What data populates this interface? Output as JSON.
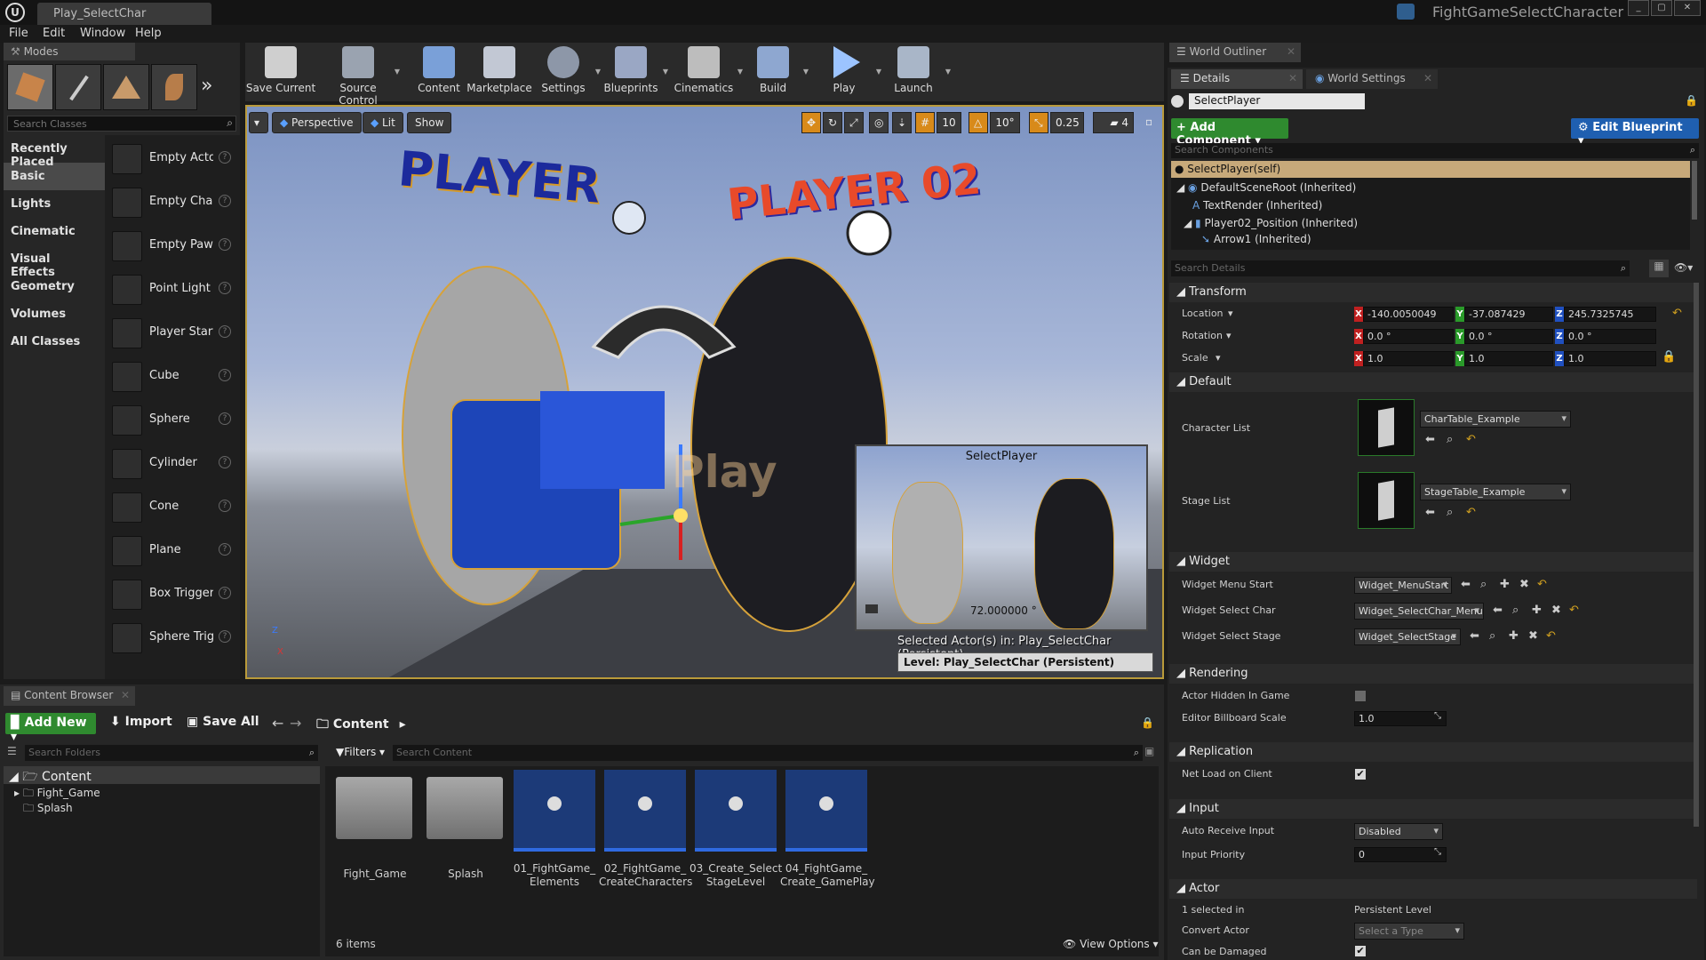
{
  "window": {
    "tab_title": "Play_SelectChar",
    "project_name": "FightGameSelectCharacter"
  },
  "menu": [
    "File",
    "Edit",
    "Window",
    "Help"
  ],
  "modes": {
    "panel_title": "Modes",
    "search_placeholder": "Search Classes",
    "categories": [
      "Recently Placed",
      "Basic",
      "Lights",
      "Cinematic",
      "Visual Effects",
      "Geometry",
      "Volumes",
      "All Classes"
    ],
    "selected_category": "Basic",
    "items": [
      "Empty Actor",
      "Empty Chara",
      "Empty Pawn",
      "Point Light",
      "Player Start",
      "Cube",
      "Sphere",
      "Cylinder",
      "Cone",
      "Plane",
      "Box Trigger",
      "Sphere Trigg"
    ]
  },
  "toolbar": [
    "Save Current",
    "Source Control",
    "Content",
    "Marketplace",
    "Settings",
    "Blueprints",
    "Cinematics",
    "Build",
    "Play",
    "Launch"
  ],
  "viewport": {
    "perspective": "Perspective",
    "lit": "Lit",
    "show": "Show",
    "snap_grid": "10",
    "snap_rot": "10°",
    "snap_scale": "0.25",
    "cam_speed": "4",
    "title_player1": "PLAYER",
    "title_player2": "PLAYER 02",
    "faded_text": "Play",
    "pip_title": "SelectPlayer",
    "pip_angle": "72.000000 °",
    "selected_actor": "Selected Actor(s) in:  Play_SelectChar (Persistent)",
    "level": "Level:  Play_SelectChar (Persistent)"
  },
  "outliner": {
    "tab": "World Outliner"
  },
  "details": {
    "tab_details": "Details",
    "tab_world": "World Settings",
    "actor_name": "SelectPlayer",
    "add_component": "+ Add Component",
    "edit_blueprint": "Edit Blueprint",
    "search_components": "Search Components",
    "components": [
      "SelectPlayer(self)",
      "DefaultSceneRoot (Inherited)",
      "TextRender (Inherited)",
      "Player02_Position (Inherited)",
      "Arrow1 (Inherited)"
    ],
    "search_details": "Search Details",
    "transform": {
      "title": "Transform",
      "location_label": "Location",
      "rotation_label": "Rotation",
      "scale_label": "Scale",
      "location": [
        "-140.0050049",
        "-37.087429",
        "245.7325745"
      ],
      "rotation": [
        "0.0 °",
        "0.0 °",
        "0.0 °"
      ],
      "scale": [
        "1.0",
        "1.0",
        "1.0"
      ]
    },
    "default": {
      "title": "Default",
      "character_list_label": "Character List",
      "character_list": "CharTable_Example",
      "stage_list_label": "Stage List",
      "stage_list": "StageTable_Example"
    },
    "widget": {
      "title": "Widget",
      "menu_start_label": "Widget Menu Start",
      "menu_start": "Widget_MenuStart",
      "select_char_label": "Widget Select Char",
      "select_char": "Widget_SelectChar_Menu",
      "select_stage_label": "Widget Select Stage",
      "select_stage": "Widget_SelectStage"
    },
    "rendering": {
      "title": "Rendering",
      "hidden_label": "Actor Hidden In Game",
      "hidden": false,
      "billboard_label": "Editor Billboard Scale",
      "billboard": "1.0"
    },
    "replication": {
      "title": "Replication",
      "net_load_label": "Net Load on Client",
      "net_load": true
    },
    "input": {
      "title": "Input",
      "auto_receive_label": "Auto Receive Input",
      "auto_receive": "Disabled",
      "priority_label": "Input Priority",
      "priority": "0"
    },
    "actor": {
      "title": "Actor",
      "selected_in_label": "1 selected in",
      "selected_in": "Persistent Level",
      "convert_label": "Convert Actor",
      "convert": "Select a Type",
      "damaged_label": "Can be Damaged",
      "damaged": true
    }
  },
  "content_browser": {
    "tab": "Content Browser",
    "add_new": "Add New",
    "import": "Import",
    "save_all": "Save All",
    "path": "Content",
    "search_folders": "Search Folders",
    "filters": "Filters",
    "search_content": "Search Content",
    "tree_root": "Content",
    "tree": [
      "Fight_Game",
      "Splash"
    ],
    "folders": [
      "Fight_Game",
      "Splash"
    ],
    "assets": [
      "01_FightGame_\nElements",
      "02_FightGame_\nCreateCharacters",
      "03_Create_Select\nStageLevel",
      "04_FightGame_\nCreate_GamePlay"
    ],
    "count": "6 items",
    "view_options": "View Options"
  },
  "colors": {
    "accent_green": "#2f8a2f",
    "accent_blue": "#1f5fb0",
    "selection": "#c7a97a"
  }
}
